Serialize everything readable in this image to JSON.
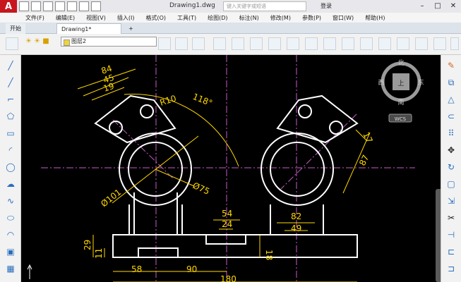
{
  "title_bar": {
    "doc_title": "Drawing1.dwg",
    "search_placeholder": "键入关键字或短语",
    "login_label": "登录"
  },
  "menus": [
    "文件(F)",
    "编辑(E)",
    "视图(V)",
    "插入(I)",
    "格式(O)",
    "工具(T)",
    "绘图(D)",
    "标注(N)",
    "修改(M)",
    "参数(P)",
    "窗口(W)",
    "帮助(H)"
  ],
  "tabs": {
    "start": "开始",
    "drawing": "Drawing1*",
    "add": "+"
  },
  "layer": {
    "current": "图层2"
  },
  "viewcube": {
    "north": "北",
    "south": "南",
    "east": "东",
    "west": "西",
    "top": "上",
    "wcs": "WCS"
  },
  "dims": {
    "d84": "84",
    "d45": "45",
    "d19": "19",
    "angle": "118°",
    "r10": "R10",
    "dia101": "Ø101",
    "dia75": "Ø75",
    "d54": "54",
    "d24": "24",
    "d82": "82",
    "d49": "49",
    "d29": "29",
    "d11": "11",
    "d18": "18",
    "d58": "58",
    "d90": "90",
    "d180": "180",
    "d17": "17",
    "d87": "87"
  },
  "colors": {
    "accent": "#c7161d",
    "canvas": "#000000",
    "dimension": "#ffd800",
    "centerline": "#c65cc6",
    "geometry": "#ffffff"
  }
}
